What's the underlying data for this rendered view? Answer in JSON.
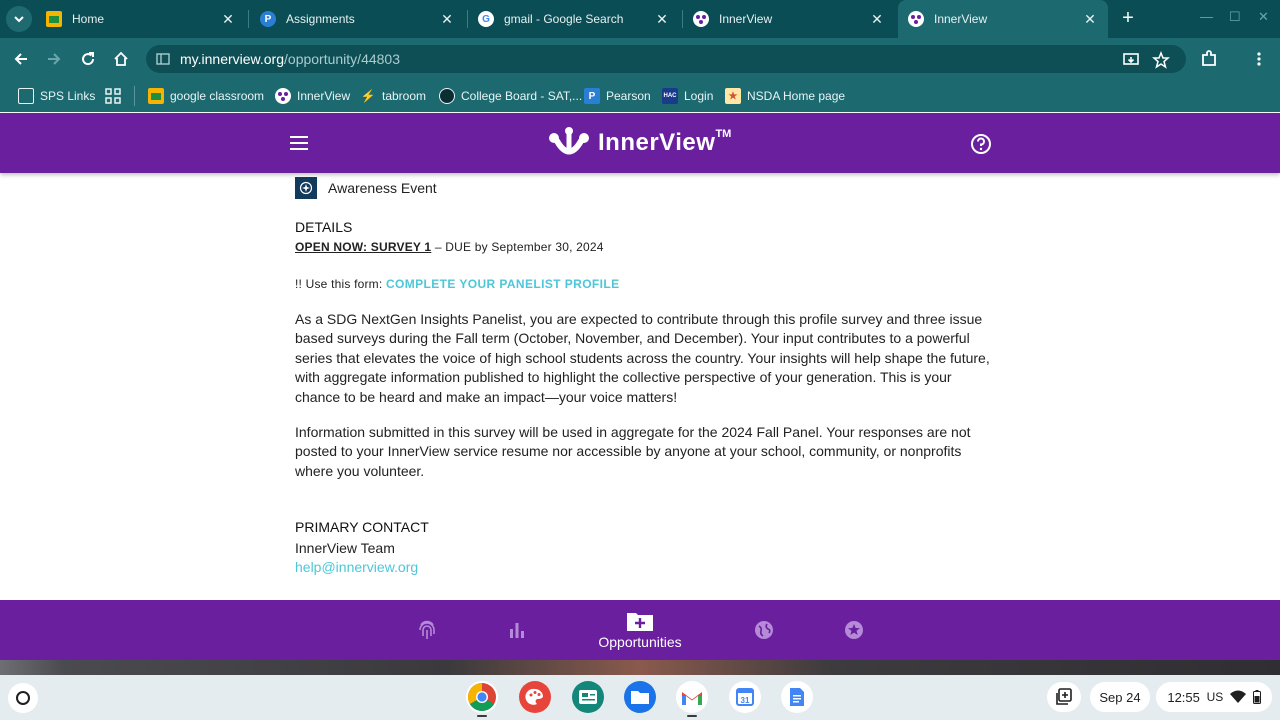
{
  "browser": {
    "tabs": [
      {
        "title": "Home",
        "icon": "google-classroom-icon",
        "active": false
      },
      {
        "title": "Assignments",
        "icon": "pearson-icon",
        "active": false
      },
      {
        "title": "gmail - Google Search",
        "icon": "google-icon",
        "active": false
      },
      {
        "title": "InnerView",
        "icon": "innerview-icon",
        "active": false
      },
      {
        "title": "InnerView",
        "icon": "innerview-icon",
        "active": true
      }
    ],
    "url": {
      "host": "my.innerview.org",
      "path": "/opportunity/44803"
    },
    "bookmarks": [
      {
        "label": "SPS Links",
        "icon": "folder-icon"
      },
      {
        "label": "",
        "icon": "apps-grid-icon"
      },
      {
        "label": "google classroom",
        "icon": "google-classroom-icon"
      },
      {
        "label": "InnerView",
        "icon": "innerview-icon"
      },
      {
        "label": "tabroom",
        "icon": "tabroom-icon"
      },
      {
        "label": "College Board - SAT,...",
        "icon": "college-board-icon"
      },
      {
        "label": "Pearson",
        "icon": "pearson-icon"
      },
      {
        "label": "Login",
        "icon": "hac-icon"
      },
      {
        "label": "NSDA Home page",
        "icon": "nsda-icon"
      }
    ]
  },
  "app": {
    "brand": "InnerView",
    "brand_mark": "TM",
    "colors": {
      "primary": "#6a1f9e",
      "link": "#4cc7d9",
      "chrome": "#1c6a70"
    },
    "event_label": "Awareness Event",
    "details_heading": "DETAILS",
    "survey_title": "OPEN NOW: SURVEY 1",
    "survey_due": " – DUE by September 30, 2024",
    "form_prefix": "!! Use this form: ",
    "form_link": "COMPLETE YOUR PANELIST PROFILE",
    "paragraph1": "As a SDG NextGen Insights Panelist, you are expected to contribute through this profile survey and three issue based surveys during the Fall term (October, November, and December).  Your input contributes to a powerful series that elevates the voice of high school students across the country. Your insights will help shape the future, with aggregate information published to highlight the collective perspective of your generation. This is your chance to be heard and make an impact—your voice matters!",
    "paragraph2": "Information submitted in this survey will be used in aggregate for the 2024 Fall Panel.  Your responses are not posted to your InnerView service resume nor accessible by anyone at your school, community, or nonprofits where you volunteer.",
    "contact_heading": "PRIMARY CONTACT",
    "contact_name": "InnerView Team",
    "contact_email": "help@innerview.org",
    "bottom_nav": [
      {
        "icon": "fingerprint-icon",
        "label": ""
      },
      {
        "icon": "bar-chart-icon",
        "label": ""
      },
      {
        "icon": "folder-plus-icon",
        "label": "Opportunities",
        "active": true
      },
      {
        "icon": "globe-icon",
        "label": ""
      },
      {
        "icon": "star-badge-icon",
        "label": ""
      }
    ]
  },
  "shelf": {
    "date": "Sep 24",
    "time": "12:55",
    "region": "US"
  }
}
